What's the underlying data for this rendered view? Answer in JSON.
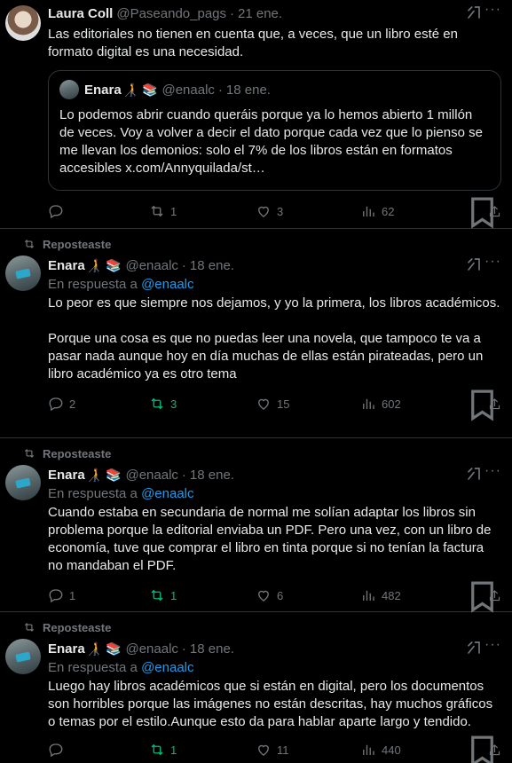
{
  "tweets": [
    {
      "name": "Laura Coll",
      "handle": "@Paseando_pags",
      "date": "21 ene.",
      "text": "Las editoriales no tienen en cuenta que, a veces, que un libro esté en formato digital es una necesidad.",
      "quote": {
        "name": "Enara",
        "emoji": "🧑‍🦯 📚",
        "handle": "@enaalc",
        "date": "18 ene.",
        "text": "Lo podemos abrir cuando queráis porque ya lo hemos abierto 1 millón de veces. Voy a volver a decir el dato porque cada vez que lo pienso se me llevan los demonios: solo el 7% de los libros están en formatos accesibles x.com/Annyquilada/st…"
      },
      "replies": "",
      "reposts": "1",
      "likes": "3",
      "views": "62"
    },
    {
      "repost_label": "Reposteaste",
      "name": "Enara",
      "emoji": "🧑‍🦯 📚",
      "handle": "@enaalc",
      "date": "18 ene.",
      "reply_prefix": "En respuesta a",
      "reply_mention": "@enaalc",
      "text": "Lo peor es que siempre nos dejamos, y yo la primera, los libros académicos.\n\nPorque una cosa es que no puedas leer una novela, que tampoco te va a pasar nada aunque hoy en día muchas de ellas están pirateadas, pero un libro académico ya es otro tema",
      "replies": "2",
      "reposts": "3",
      "likes": "15",
      "views": "602"
    },
    {
      "repost_label": "Reposteaste",
      "name": "Enara",
      "emoji": "🧑‍🦯 📚",
      "handle": "@enaalc",
      "date": "18 ene.",
      "reply_prefix": "En respuesta a",
      "reply_mention": "@enaalc",
      "text": "Cuando estaba en secundaria de normal me solían adaptar los libros sin problema porque la editorial enviaba un PDF. Pero una vez, con un libro de economía, tuve que comprar el libro en tinta porque si no tenían la factura no mandaban el PDF.",
      "replies": "1",
      "reposts": "1",
      "likes": "6",
      "views": "482"
    },
    {
      "repost_label": "Reposteaste",
      "name": "Enara",
      "emoji": "🧑‍🦯 📚",
      "handle": "@enaalc",
      "date": "18 ene.",
      "reply_prefix": "En respuesta a",
      "reply_mention": "@enaalc",
      "text": "Luego hay libros académicos que si están en digital, pero los documentos son horribles porque las imágenes no están descritas, hay muchos gráficos o temas por el estilo.Aunque esto da para hablar aparte largo y tendido.",
      "replies": "",
      "reposts": "1",
      "likes": "11",
      "views": "440"
    }
  ],
  "colors": {
    "background": "#000000",
    "text": "#e7e9ea",
    "muted": "#71767b",
    "link": "#1d9bf0",
    "retweet_active": "#00ba7c",
    "border": "#2f3336"
  }
}
